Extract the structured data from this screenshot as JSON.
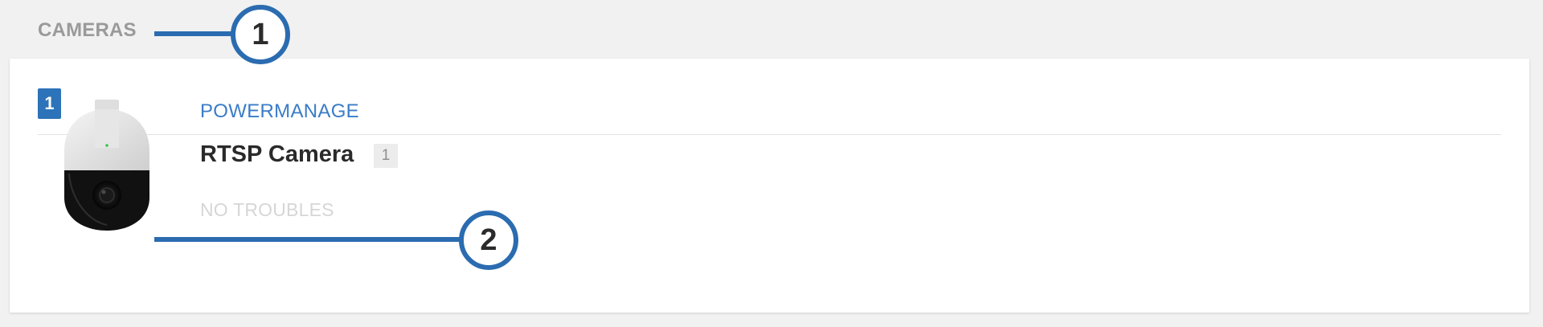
{
  "section": {
    "title": "CAMERAS"
  },
  "group": {
    "badge": "1"
  },
  "device": {
    "image_icon": "ptz-dome-camera-icon",
    "panel_name": "POWERMANAGE",
    "name": "RTSP Camera",
    "id_badge": "1",
    "status": "NO TROUBLES"
  },
  "callouts": [
    {
      "number": "1"
    },
    {
      "number": "2"
    }
  ],
  "colors": {
    "background": "#f1f1f1",
    "accent": "#2d73b9",
    "callout": "#2b6cb0",
    "panel_name": "#3a7cc8",
    "status_muted": "#d6d6d6"
  }
}
